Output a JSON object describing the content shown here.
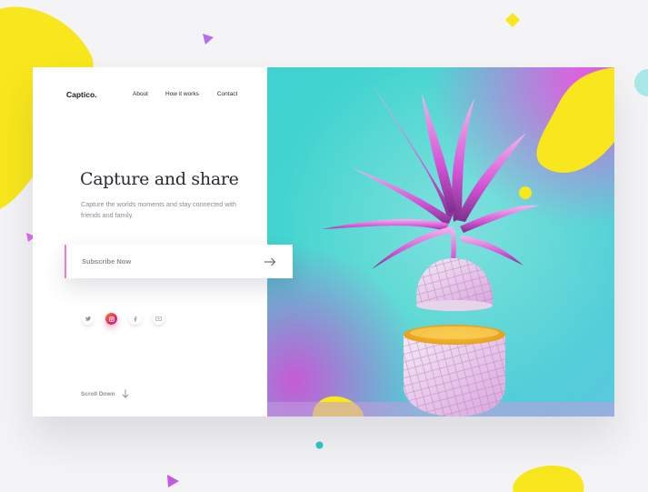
{
  "brand": {
    "logo": "Captico."
  },
  "nav": {
    "items": [
      "About",
      "How it works",
      "Contact"
    ]
  },
  "hero": {
    "headline": "Capture and share",
    "subtext": "Capture the worlds moments and stay connected with friends and family."
  },
  "subscribe": {
    "label": "Subscribe Now",
    "icon": "arrow-right-icon"
  },
  "socials": [
    {
      "name": "twitter",
      "icon": "twitter-icon"
    },
    {
      "name": "instagram",
      "icon": "instagram-icon"
    },
    {
      "name": "facebook",
      "icon": "facebook-icon"
    },
    {
      "name": "youtube",
      "icon": "youtube-icon"
    }
  ],
  "scroll": {
    "label": "Scroll Down",
    "icon": "arrow-down-icon"
  },
  "colors": {
    "accent_pink": "#e97fd4",
    "yellow": "#f8e71c",
    "teal": "#3fd2d0",
    "purple": "#b26ef0",
    "magenta": "#e65ae0"
  }
}
